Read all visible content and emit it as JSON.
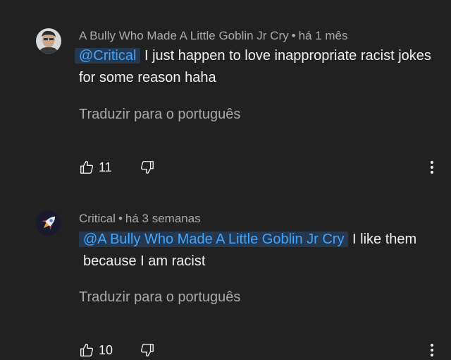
{
  "comments": [
    {
      "author": "A Bully Who Made A Little Goblin Jr Cry",
      "separator": "•",
      "time": "há 1 mês",
      "mention": "@Critical",
      "text": "I just happen to love inappropriate racist jokes for some reason haha",
      "translate_label": "Traduzir para o português",
      "likes": "11",
      "avatar_icon": "person-photo-avatar"
    },
    {
      "author": "Critical",
      "separator": "•",
      "time": "há 3 semanas",
      "mention": "@A Bully Who Made A Little Goblin Jr Cry",
      "text": "I like them because I am racist",
      "translate_label": "Traduzir para o português",
      "likes": "10",
      "avatar_icon": "rocket-avatar"
    }
  ],
  "colors": {
    "background": "#212121",
    "primary_text": "#f1f1f1",
    "secondary_text": "#aaaaaa",
    "mention_text": "#3ea6ff",
    "mention_bg": "#263850"
  }
}
